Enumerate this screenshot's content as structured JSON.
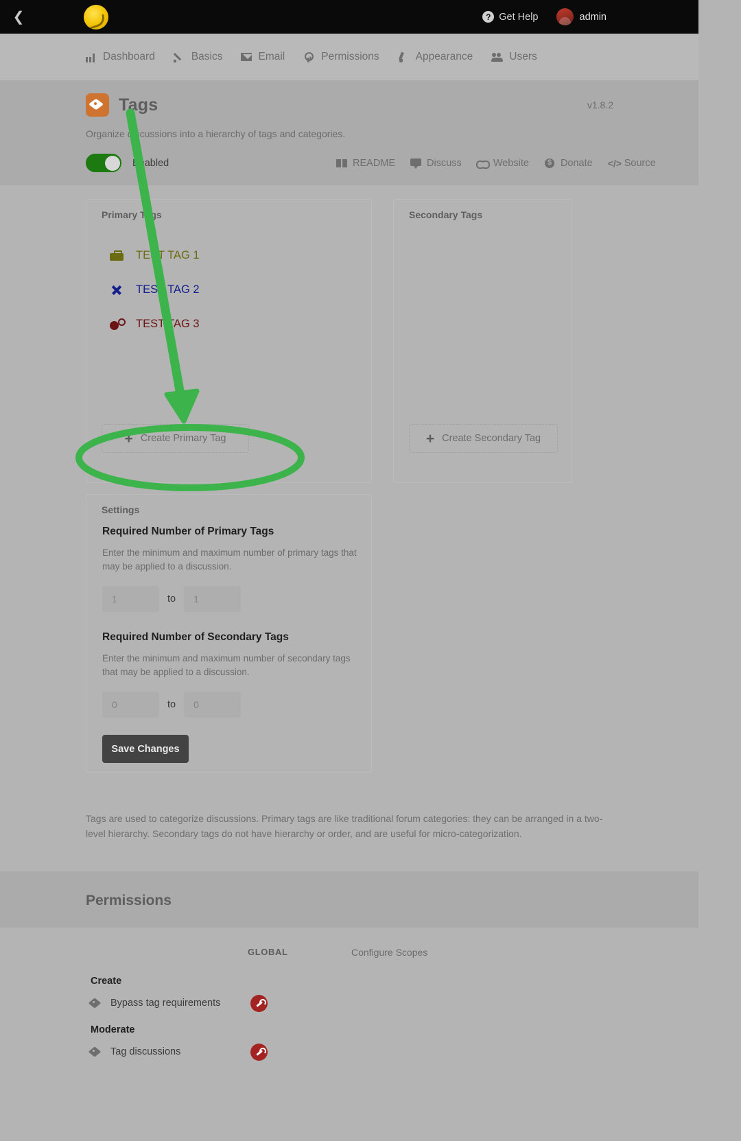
{
  "topbar": {
    "back_icon": "chevron-left-icon",
    "logo_alt": "forum-logo",
    "help_label": "Get Help",
    "help_icon": "question-circle-icon",
    "user_name": "admin",
    "avatar_alt": "user-avatar"
  },
  "nav": {
    "items": [
      {
        "label": "Dashboard",
        "icon": "chart-bar-icon"
      },
      {
        "label": "Basics",
        "icon": "pencil-icon"
      },
      {
        "label": "Email",
        "icon": "envelope-icon"
      },
      {
        "label": "Permissions",
        "icon": "key-icon"
      },
      {
        "label": "Appearance",
        "icon": "paint-brush-icon"
      },
      {
        "label": "Users",
        "icon": "users-icon"
      }
    ]
  },
  "extension": {
    "icon": "tag-icon",
    "title": "Tags",
    "version": "v1.8.2",
    "description": "Organize discussions into a hierarchy of tags and categories.",
    "toggle_label": "Enabled",
    "toggle_on": true,
    "toggle_color": "#1d7a10",
    "icon_color": "#cf7430",
    "links": [
      {
        "label": "README",
        "icon": "book-icon"
      },
      {
        "label": "Discuss",
        "icon": "chat-icon"
      },
      {
        "label": "Website",
        "icon": "link-icon"
      },
      {
        "label": "Donate",
        "icon": "dollar-circle-icon"
      },
      {
        "label": "Source",
        "icon": "code-icon"
      }
    ]
  },
  "primary_panel": {
    "title": "Primary Tags",
    "tags": [
      {
        "name": "TEST TAG 1",
        "icon": "toolbox-icon",
        "color": "#6b6b12"
      },
      {
        "name": "TEST TAG 2",
        "icon": "tools-icon",
        "color": "#141e8c"
      },
      {
        "name": "TEST TAG 3",
        "icon": "cogs-icon",
        "color": "#6b1414"
      }
    ],
    "create_label": "Create Primary Tag",
    "create_icon": "plus-icon"
  },
  "secondary_panel": {
    "title": "Secondary Tags",
    "tags": [],
    "create_label": "Create Secondary Tag",
    "create_icon": "plus-icon"
  },
  "settings": {
    "title": "Settings",
    "primary": {
      "heading": "Required Number of Primary Tags",
      "description": "Enter the minimum and maximum number of primary tags that may be applied to a discussion.",
      "min_value": "1",
      "max_value": "1",
      "separator": "to"
    },
    "secondary": {
      "heading": "Required Number of Secondary Tags",
      "description": "Enter the minimum and maximum number of secondary tags that may be applied to a discussion.",
      "min_value": "0",
      "max_value": "0",
      "separator": "to"
    },
    "save_label": "Save Changes"
  },
  "footnote": "Tags are used to categorize discussions. Primary tags are like traditional forum categories: they can be arranged in a two-level hierarchy. Secondary tags do not have hierarchy or order, and are useful for micro-categorization.",
  "permissions": {
    "title": "Permissions",
    "column_global": "GLOBAL",
    "configure_scopes": "Configure Scopes",
    "groups": [
      {
        "name": "Create",
        "rows": [
          {
            "label": "Bypass tag requirements",
            "icon": "tag-icon",
            "badge": "wrench-icon",
            "badge_color": "#a32222"
          }
        ]
      },
      {
        "name": "Moderate",
        "rows": [
          {
            "label": "Tag discussions",
            "icon": "tag-icon",
            "badge": "wrench-icon",
            "badge_color": "#a32222"
          }
        ]
      }
    ]
  },
  "annotation": {
    "color": "#3cb44b",
    "shapes": [
      "arrow",
      "ellipse"
    ],
    "target": "Create Primary Tag"
  }
}
